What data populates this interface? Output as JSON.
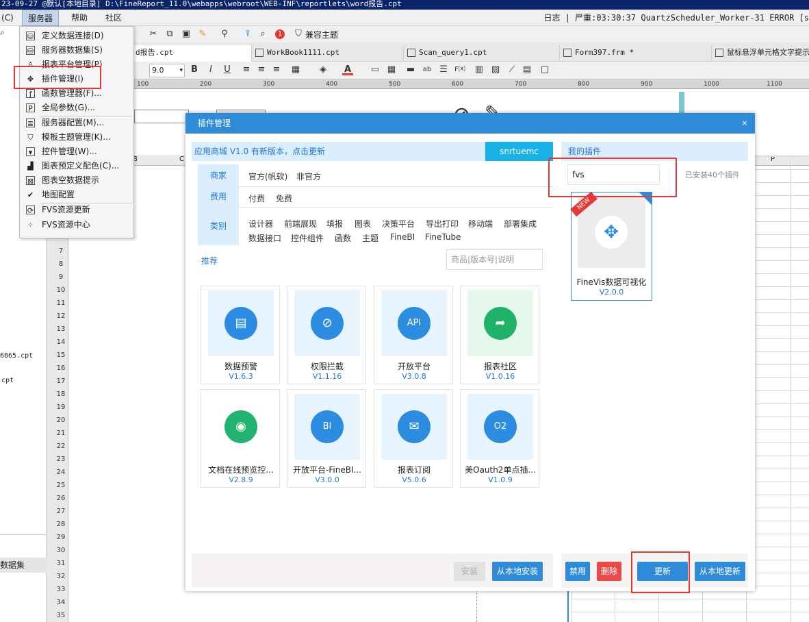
{
  "window": {
    "title": "23-09-27 @默认[本地目录]    D:\\FineReport_11.0\\webapps\\webroot\\WEB-INF\\reportlets\\word报告.cpt",
    "status": "日志 | 严重:03:30:37 QuartzScheduler_Worker-31 ERROR [s"
  },
  "menubar": {
    "items": [
      "(C)",
      "服务器",
      "帮助",
      "社区"
    ],
    "active": "服务器"
  },
  "toolbar": {
    "theme_label": "兼容主题",
    "badge": "1"
  },
  "tabs": [
    {
      "label": "d报告.cpt",
      "active": true
    },
    {
      "label": "WorkBook1111.cpt",
      "active": false
    },
    {
      "label": "Scan_query1.cpt",
      "active": false
    },
    {
      "label": "Form397.frm *",
      "active": false
    },
    {
      "label": "鼠标悬浮单元格文字提示",
      "active": false
    }
  ],
  "format_toolbar": {
    "font_size": "9.0"
  },
  "ruler": {
    "marks": [
      "100",
      "200",
      "300",
      "400",
      "500",
      "600",
      "700",
      "800",
      "900",
      "1000",
      "1100"
    ]
  },
  "left_pane": {
    "files": [
      "6865.cpt",
      "cpt"
    ],
    "dataset_label": "数据集"
  },
  "rows": [
    "7",
    "8",
    "9",
    "10",
    "11",
    "12",
    "13",
    "14",
    "15",
    "16",
    "17",
    "18",
    "19",
    "20",
    "21",
    "22",
    "23",
    "24",
    "25",
    "26",
    "27",
    "28",
    "29",
    "30",
    "31",
    "32",
    "33",
    "34",
    "35"
  ],
  "columns": {
    "b": "B",
    "c": "C",
    "p": "P"
  },
  "server_menu": {
    "items": [
      {
        "label": "定义数据连接(D)",
        "icon": "database-connection-icon"
      },
      {
        "label": "服务器数据集(S)",
        "icon": "server-dataset-icon"
      },
      {
        "label": "报表平台管理(P)",
        "icon": "platform-user-icon"
      },
      {
        "label": "插件管理(I)",
        "icon": "plugin-puzzle-icon"
      },
      {
        "label": "函数管理器(F)...",
        "icon": "function-manager-icon"
      },
      {
        "label": "全局参数(G)...",
        "icon": "global-param-icon"
      },
      {
        "label": "服务器配置(M)...",
        "icon": "server-config-icon"
      },
      {
        "label": "模板主题管理(K)...",
        "icon": "theme-shirt-icon"
      },
      {
        "label": "控件管理(W)...",
        "icon": "widget-manager-icon"
      },
      {
        "label": "图表预定义配色(C)...",
        "icon": "chart-color-icon"
      },
      {
        "label": "图表空数据提示",
        "icon": "chart-empty-icon"
      },
      {
        "label": "地图配置",
        "icon": "map-config-icon"
      },
      {
        "label": "FVS资源更新",
        "icon": "fvs-update-icon"
      },
      {
        "label": "FVS资源中心",
        "icon": "fvs-center-icon"
      }
    ]
  },
  "dialog": {
    "title": "插件管理",
    "close": "×",
    "store": {
      "version_text": "应用商城 V1.0",
      "update_text": "有新版本，点击更新",
      "account": "snrtuemc",
      "filters": {
        "vendor_label": "商家",
        "vendor_options": [
          "官方(帆软)",
          "非官方"
        ],
        "fee_label": "费用",
        "fee_options": [
          "付费",
          "免费"
        ],
        "category_label": "类别",
        "category_options": [
          "设计器",
          "前端展现",
          "填报",
          "图表",
          "决策平台",
          "导出打印",
          "移动端",
          "部署集成",
          "数据接口",
          "控件组件",
          "函数",
          "主题",
          "FineBI",
          "FineTube"
        ]
      },
      "recommend_label": "推荐",
      "search_placeholder": "商品|版本号|说明",
      "cards": [
        {
          "name": "数据预警",
          "version": "V1.6.3",
          "glyph": "▤"
        },
        {
          "name": "权限拦截",
          "version": "V1.1.16",
          "glyph": "⊘"
        },
        {
          "name": "开放平台",
          "version": "V3.0.8",
          "glyph": "API"
        },
        {
          "name": "报表社区",
          "version": "V1.0.16",
          "glyph": "➦"
        },
        {
          "name": "文档在线预览控...",
          "version": "V2.8.9",
          "glyph": "◉"
        },
        {
          "name": "开放平台-FineBI...",
          "version": "V3.0.0",
          "glyph": "BI"
        },
        {
          "name": "报表订阅",
          "version": "V5.0.6",
          "glyph": "✉"
        },
        {
          "name": "美Oauth2单点插...",
          "version": "V1.0.9",
          "glyph": "O2"
        }
      ],
      "install_btn": "安装",
      "local_install_btn": "从本地安装"
    },
    "mine": {
      "title": "我的插件",
      "search_value": "fvs",
      "installed_text": "已安装40个插件",
      "card": {
        "name": "FineVis数据可视化",
        "version": "V2.0.0",
        "badge": "NEW"
      },
      "disable_btn": "禁用",
      "delete_btn": "删除",
      "update_btn": "更新",
      "local_update_btn": "从本地更新"
    }
  },
  "colors": {
    "accent": "#2f8bd8",
    "highlight": "#e53935",
    "delete": "#e94a4a"
  }
}
